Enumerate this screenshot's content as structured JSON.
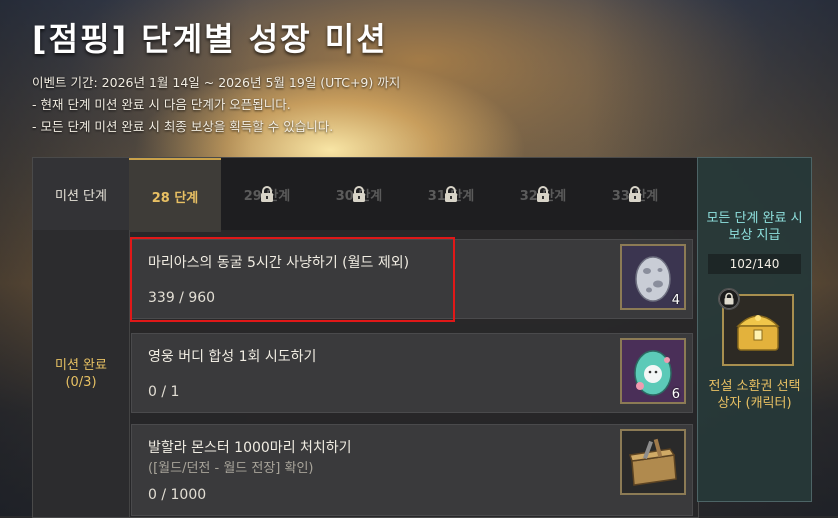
{
  "header": {
    "title": "[점핑] 단계별 성장 미션",
    "period": "이벤트 기간: 2026년 1월 14일 ~ 2026년 5월 19일 (UTC+9) 까지",
    "notes": [
      "- 현재 단계 미션 완료 시 다음 단계가 오픈됩니다.",
      "- 모든 단계 미션 완료 시 최종 보상을 획득할 수 있습니다."
    ]
  },
  "tabs": {
    "section_label": "미션 단계",
    "items": [
      {
        "label": "28 단계",
        "locked": false
      },
      {
        "label": "29 단계",
        "locked": true
      },
      {
        "label": "30 단계",
        "locked": true
      },
      {
        "label": "31 단계",
        "locked": true
      },
      {
        "label": "32 단계",
        "locked": true
      },
      {
        "label": "33 단계",
        "locked": true
      }
    ]
  },
  "sidebar": {
    "line1": "미션 완료",
    "line2": "(0/3)"
  },
  "missions": [
    {
      "name": "마리아스의 동굴 5시간 사냥하기 (월드 제외)",
      "sub": "",
      "progress": "339 / 960",
      "reward_icon": "silver-egg-icon",
      "reward_count": "4"
    },
    {
      "name": "영웅 버디 합성 1회 시도하기",
      "sub": "",
      "progress": "0 / 1",
      "reward_icon": "buddy-egg-icon",
      "reward_count": "6"
    },
    {
      "name": "발할라 몬스터 1000마리 처치하기",
      "sub": "([월드/던전 - 월드 전장] 확인)",
      "progress": "0 / 1000",
      "reward_icon": "toolbox-icon",
      "reward_count": ""
    }
  ],
  "final_reward": {
    "title_line1": "모든 단계 완료 시",
    "title_line2": "보상 지급",
    "count": "102/140",
    "icon": "golden-chest-icon",
    "name_line1": "전설 소환권 선택",
    "name_line2": "상자 (캐릭터)"
  },
  "colors": {
    "accent_gold": "#e8c063",
    "accent_teal": "#8ee0dd",
    "highlight_red": "#e01818"
  }
}
